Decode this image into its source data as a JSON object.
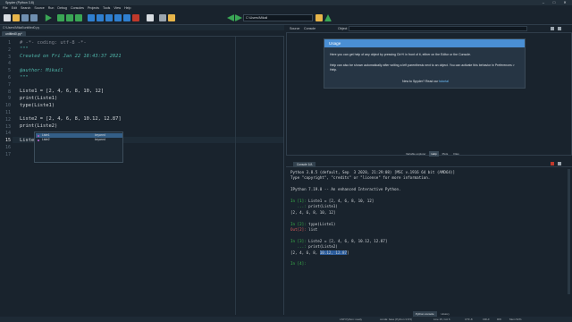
{
  "window": {
    "title": "Spyder (Python 3.8)",
    "controls": [
      "–",
      "□",
      "✕"
    ]
  },
  "menu": [
    "File",
    "Edit",
    "Search",
    "Source",
    "Run",
    "Debug",
    "Consoles",
    "Projects",
    "Tools",
    "View",
    "Help"
  ],
  "toolbar": {
    "path": "C:\\Users\\Mikail",
    "icons": [
      "new-file-icon",
      "open-folder-icon",
      "save-icon",
      "save-all-icon",
      "run-icon",
      "run-cell-icon",
      "run-cell-advance-icon",
      "debug-icon",
      "step-icon",
      "stop-icon",
      "maximize-icon",
      "preferences-icon",
      "python-path-icon",
      "back-icon",
      "forward-icon",
      "browse-folder-icon"
    ]
  },
  "editor": {
    "path": "C:\\Users\\Mikail\\untitled0.py",
    "tab": "untitled0.py*",
    "current_line": 15,
    "lines": [
      {
        "n": "1",
        "text": "# -*- coding: utf-8 -*-",
        "cls": "c-comment"
      },
      {
        "n": "2",
        "text": "\"\"\"",
        "cls": "c-italic"
      },
      {
        "n": "3",
        "text": "Created on Fri Jan 22 18:43:37 2021",
        "cls": "c-italic"
      },
      {
        "n": "4",
        "text": "",
        "cls": "c-italic"
      },
      {
        "n": "5",
        "text": "@author: Mikail",
        "cls": "c-italic"
      },
      {
        "n": "6",
        "text": "\"\"\"",
        "cls": "c-italic"
      },
      {
        "n": "7",
        "text": "",
        "cls": "c-fn"
      },
      {
        "n": "8",
        "text": "Liste1 = [2, 4, 6, 8, 10, 12]",
        "cls": "c-fn"
      },
      {
        "n": "9",
        "text": "print(Liste1)",
        "cls": "c-fn"
      },
      {
        "n": "10",
        "text": "type(Liste1)",
        "cls": "c-fn"
      },
      {
        "n": "11",
        "text": "",
        "cls": "c-fn"
      },
      {
        "n": "12",
        "text": "Liste2 = [2, 4, 6, 8, 10.12, 12.87]",
        "cls": "c-fn"
      },
      {
        "n": "13",
        "text": "print(Liste2)",
        "cls": "c-fn"
      },
      {
        "n": "14",
        "text": "",
        "cls": "c-fn"
      },
      {
        "n": "15",
        "text": "Liste",
        "cls": "c-fn"
      },
      {
        "n": "16",
        "text": "",
        "cls": "c-fn"
      },
      {
        "n": "17",
        "text": "",
        "cls": "c-fn"
      }
    ]
  },
  "autocomplete": {
    "items": [
      {
        "label": "Liste1",
        "kind": "keyword"
      },
      {
        "label": "Liste2",
        "kind": "keyword"
      }
    ]
  },
  "help": {
    "header_tabs": [
      "Source",
      "Console"
    ],
    "object_label": "Object",
    "usage_title": "Usage",
    "usage_p1": "Here you can get help of any object by pressing Ctrl+I in front of it, either on the Editor or the Console.",
    "usage_p2": "Help can also be shown automatically after writing a left parenthesis next to an object. You can activate this behavior in Preferences > Help.",
    "usage_p3_prefix": "New to Spyder? Read our",
    "usage_p3_link": "tutorial",
    "bottom_tabs": [
      "Variable explorer",
      "Help",
      "Plots",
      "Files"
    ],
    "active_tab": "Help"
  },
  "console": {
    "tab": "Console 1/A",
    "bottom_tabs": [
      "Python console",
      "History"
    ],
    "lines": [
      {
        "parts": [
          {
            "t": "Python 3.8.5 (default, Sep  3 2020, 21:29:08) [MSC v.1916 64 bit (AMD64)]",
            "c": ""
          }
        ]
      },
      {
        "parts": [
          {
            "t": "Type \"copyright\", \"credits\" or \"license\" for more information.",
            "c": ""
          }
        ]
      },
      {
        "parts": [
          {
            "t": "",
            "c": ""
          }
        ]
      },
      {
        "parts": [
          {
            "t": "IPython 7.19.0 -- An enhanced Interactive Python.",
            "c": ""
          }
        ]
      },
      {
        "parts": [
          {
            "t": "",
            "c": ""
          }
        ]
      },
      {
        "parts": [
          {
            "t": "In [1]: ",
            "c": "prompt"
          },
          {
            "t": "Liste1 = [2, 4, 6, 8, 10, 12]",
            "c": ""
          }
        ]
      },
      {
        "parts": [
          {
            "t": "   ...: ",
            "c": "cont"
          },
          {
            "t": "print(Liste1)",
            "c": ""
          }
        ]
      },
      {
        "parts": [
          {
            "t": "[2, 4, 6, 8, 10, 12]",
            "c": ""
          }
        ]
      },
      {
        "parts": [
          {
            "t": "",
            "c": ""
          }
        ]
      },
      {
        "parts": [
          {
            "t": "In [2]: ",
            "c": "prompt"
          },
          {
            "t": "type(Liste1)",
            "c": ""
          }
        ]
      },
      {
        "parts": [
          {
            "t": "Out[2]: ",
            "c": "err"
          },
          {
            "t": "list",
            "c": ""
          }
        ]
      },
      {
        "parts": [
          {
            "t": "",
            "c": ""
          }
        ]
      },
      {
        "parts": [
          {
            "t": "In [3]: ",
            "c": "prompt"
          },
          {
            "t": "Liste2 = [2, 4, 6, 8, 10.12, 12.87]",
            "c": ""
          }
        ]
      },
      {
        "parts": [
          {
            "t": "   ...: ",
            "c": "cont"
          },
          {
            "t": "print(Liste2)",
            "c": ""
          }
        ]
      },
      {
        "parts": [
          {
            "t": "[2, 4, 6, 8, ",
            "c": ""
          },
          {
            "t": "10.12, 12.87",
            "c": "hl"
          },
          {
            "t": "]",
            "c": ""
          }
        ]
      },
      {
        "parts": [
          {
            "t": "",
            "c": ""
          }
        ]
      },
      {
        "parts": [
          {
            "t": "In [4]: ",
            "c": "prompt"
          }
        ]
      }
    ]
  },
  "status": {
    "lsp": "LSP Python: ready",
    "conda": "conda: base (Python 3.8.5)",
    "position": "Line 15, Col 6",
    "encoding": "UTF-8",
    "eol": "CRLF",
    "rw": "RW",
    "mem": "Mem 52%"
  },
  "colors": {
    "background": "#19232d",
    "accent": "#4a8fd4",
    "prompt_green": "#3ab54a",
    "out_red": "#e05c5c"
  }
}
